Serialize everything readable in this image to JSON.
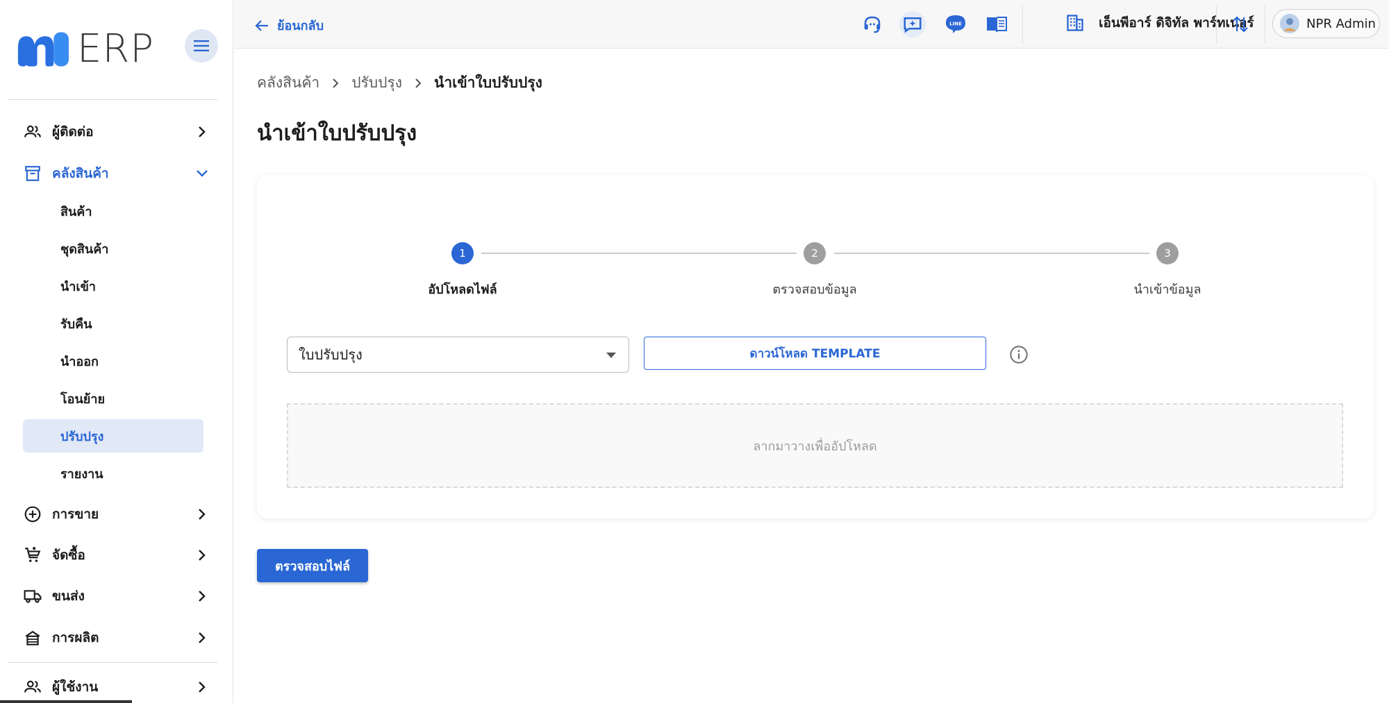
{
  "sidebar": {
    "logo_text": "ERP",
    "nav": [
      {
        "label": "ผู้ติดต่อ",
        "icon": "contacts-icon"
      },
      {
        "label": "คลังสินค้า",
        "icon": "warehouse-icon"
      },
      {
        "label": "การขาย",
        "icon": "sales-icon"
      },
      {
        "label": "จัดซื้อ",
        "icon": "purchase-cart-icon"
      },
      {
        "label": "ขนส่ง",
        "icon": "truck-icon"
      },
      {
        "label": "การผลิต",
        "icon": "factory-icon"
      },
      {
        "label": "ผู้ใช้งาน",
        "icon": "users-icon"
      }
    ],
    "warehouse_sub": [
      "สินค้า",
      "ชุดสินค้า",
      "นำเข้า",
      "รับคืน",
      "นำออก",
      "โอนย้าย",
      "ปรับปรุง",
      "รายงาน"
    ],
    "selected_sub": "ปรับปรุง"
  },
  "topbar": {
    "back_label": "ย้อนกลับ",
    "company_name": "เอ็นพีอาร์ ดิจิทัล พาร์ทเนอร์",
    "user_name": "NPR Admin",
    "line_label": "LINE"
  },
  "breadcrumb": [
    "คลังสินค้า",
    "ปรับปรุง",
    "นำเข้าใบปรับปรุง"
  ],
  "page_title": "นำเข้าใบปรับปรุง",
  "steps": [
    {
      "num": "1",
      "label": "อัปโหลดไฟล์",
      "active": true
    },
    {
      "num": "2",
      "label": "ตรวจสอบข้อมูล",
      "active": false
    },
    {
      "num": "3",
      "label": "นำเข้าข้อมูล",
      "active": false
    }
  ],
  "form": {
    "doc_type_value": "ใบปรับปรุง",
    "download_template_label": "ดาวน์โหลด TEMPLATE",
    "dropzone_text": "ลากมาวางเพื่ออัปโหลด",
    "verify_button_label": "ตรวจสอบไฟล์"
  },
  "colors": {
    "accent": "#2a66d4",
    "step_inactive": "#9e9e9e",
    "selected_bg": "#e1e8f6"
  }
}
